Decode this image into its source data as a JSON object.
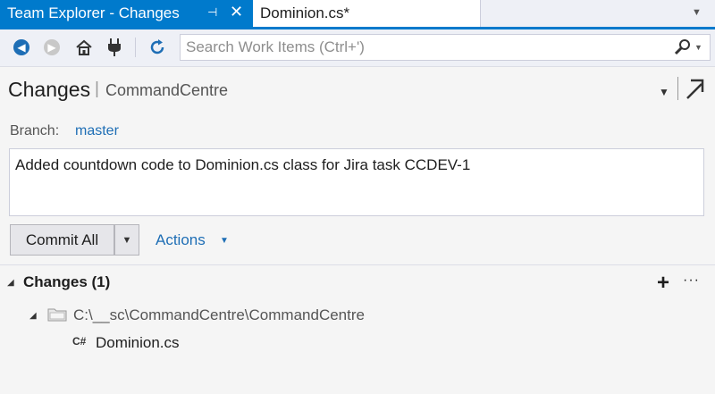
{
  "tabs": [
    {
      "label": "Team Explorer - Changes",
      "active": true
    },
    {
      "label": "Dominion.cs*",
      "active": false
    }
  ],
  "toolbar": {
    "icons": [
      "back-icon",
      "forward-icon",
      "home-icon",
      "connect-icon",
      "refresh-icon"
    ],
    "search_placeholder": "Search Work Items (Ctrl+')"
  },
  "header": {
    "title": "Changes",
    "subtitle": "CommandCentre"
  },
  "branch": {
    "label": "Branch:",
    "name": "master"
  },
  "commit": {
    "message": "Added countdown code to Dominion.cs class for Jira task CCDEV-1",
    "button_label": "Commit All",
    "actions_label": "Actions"
  },
  "changes": {
    "title": "Changes (1)",
    "folder_path": "C:\\__sc\\CommandCentre\\CommandCentre",
    "files": [
      {
        "type_badge": "C#",
        "name": "Dominion.cs"
      }
    ]
  },
  "colors": {
    "accent": "#007acc",
    "link": "#1e6eb5"
  }
}
